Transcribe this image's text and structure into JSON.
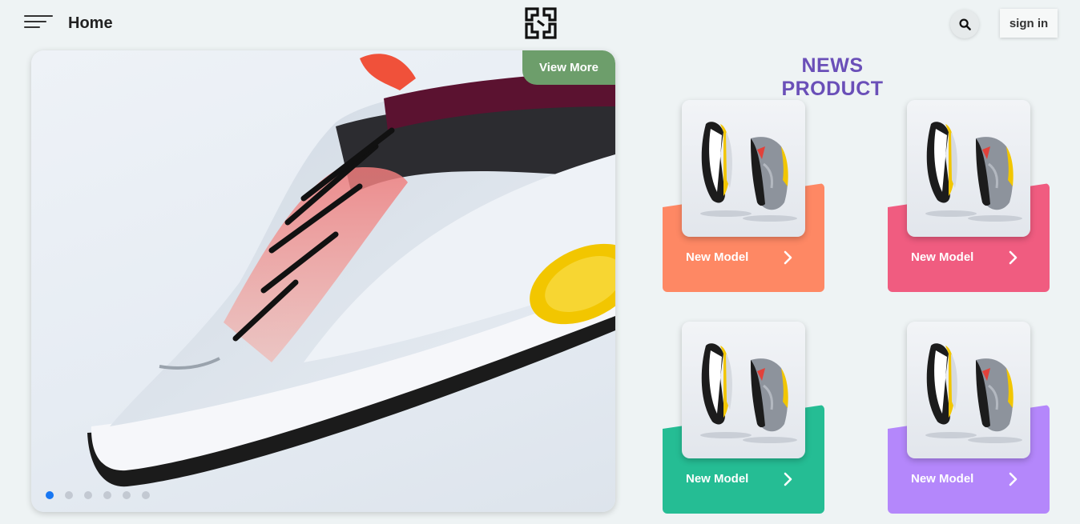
{
  "header": {
    "menu_icon": "hamburger-menu-icon",
    "home_label": "Home",
    "logo_icon": "brand-logo",
    "search_icon": "search-icon",
    "signin_label": "sign in"
  },
  "hero": {
    "view_more_label": "View More",
    "slides_count": 6,
    "active_slide": 1
  },
  "news": {
    "title": "NEWS PRODUCT",
    "cards": [
      {
        "label": "New Model",
        "color": "#fe8864"
      },
      {
        "label": "New Model",
        "color": "#f05c80"
      },
      {
        "label": "New Model",
        "color": "#25bd94"
      },
      {
        "label": "New Model",
        "color": "#b487fb"
      }
    ]
  },
  "colors": {
    "background": "#eef3f4",
    "accent_title": "#6a4fb8",
    "view_more": "#6d9e6b",
    "active_dot": "#1877f2"
  }
}
